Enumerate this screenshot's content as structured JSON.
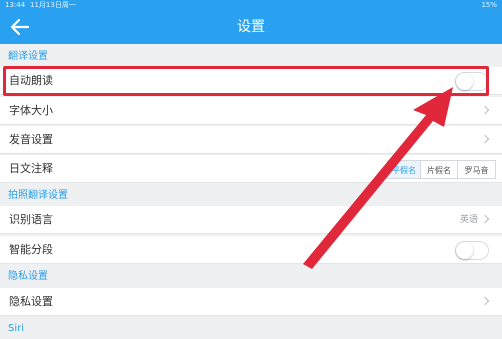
{
  "status_bar": {
    "time": "13:44",
    "date": "11月13日周一",
    "battery": "15%"
  },
  "header": {
    "title": "设置",
    "back_icon": "back-arrow-icon"
  },
  "sections": [
    {
      "title": "翻译设置"
    },
    {
      "title": "拍照翻译设置"
    },
    {
      "title": "隐私设置"
    },
    {
      "title": "Siri"
    }
  ],
  "rows": {
    "auto_read": {
      "label": "自动朗读",
      "toggle_on": false
    },
    "font_size": {
      "label": "字体大小"
    },
    "pronunciation": {
      "label": "发音设置"
    },
    "japanese_note": {
      "label": "日文注释",
      "options": [
        "平假名",
        "片假名",
        "罗马音"
      ],
      "selected": "平假名"
    },
    "recognize_lang": {
      "label": "识别语言",
      "value": "英语"
    },
    "smart_segment": {
      "label": "智能分段",
      "toggle_on": false
    },
    "privacy": {
      "label": "隐私设置"
    }
  },
  "colors": {
    "accent": "#2aa1f0",
    "highlight": "#e0283a"
  }
}
